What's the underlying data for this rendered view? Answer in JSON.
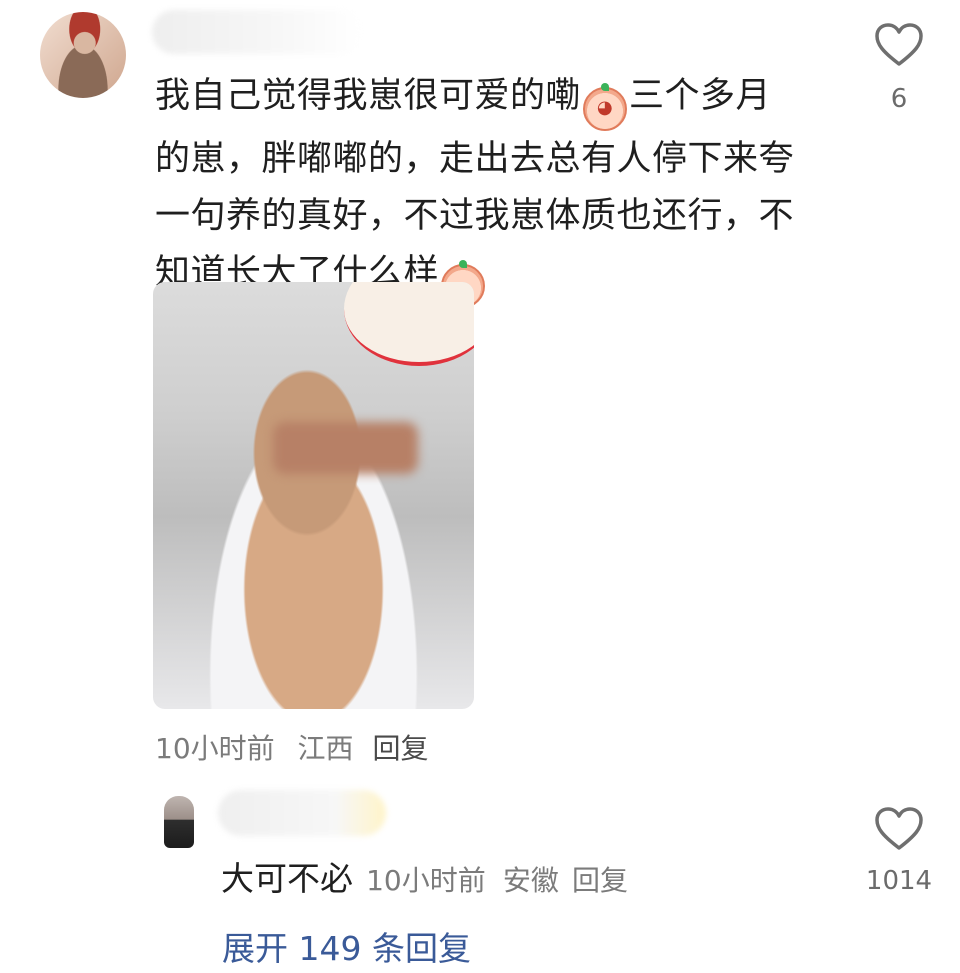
{
  "comment": {
    "text_parts": [
      "我自己觉得我崽很可爱的嘞",
      "三个多月的崽，胖嘟嘟的，走出去总有人停下来夸一句养的真好，不过我崽体质也还行，不知道长大了什么样"
    ],
    "like_count": "6",
    "meta": {
      "time": "10小时前",
      "location": "江西",
      "reply_label": "回复"
    }
  },
  "reply": {
    "text": "大可不必",
    "like_count": "1014",
    "meta": {
      "time": "10小时前",
      "location": "安徽",
      "reply_label": "回复"
    }
  },
  "expand": {
    "label": "展开 149 条回复"
  },
  "icons": {
    "like": "heart-outline-icon",
    "emoji_1": "blushing-face-emoji",
    "emoji_2": "crying-laughing-face-emoji"
  },
  "colors": {
    "link": "#3a5a98",
    "meta": "#7b7b7b",
    "icon": "#6f6f6f"
  }
}
